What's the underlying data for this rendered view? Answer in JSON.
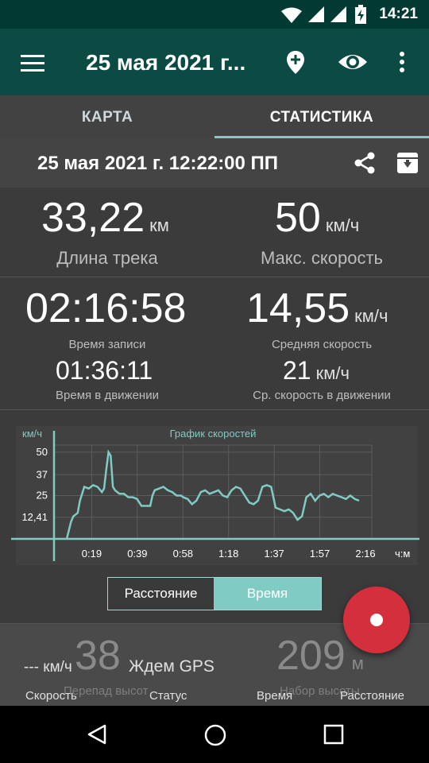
{
  "status_bar": {
    "time": "14:21",
    "icons": [
      "wifi-icon",
      "signal-icon",
      "signal-icon",
      "battery-charging-icon"
    ]
  },
  "app_bar": {
    "title": "25 мая 2021 г...",
    "icons": [
      "menu-icon",
      "add-marker-icon",
      "eye-icon",
      "more-vertical-icon"
    ]
  },
  "tabs": [
    {
      "label": "КАРТА"
    },
    {
      "label": "СТАТИСТИКА",
      "selected": true
    }
  ],
  "track": {
    "datetime": "25 мая 2021 г. 12:22:00 ПП",
    "icons": [
      "share-icon",
      "archive-icon"
    ]
  },
  "stats": {
    "distance": {
      "value": "33,22",
      "unit": "км",
      "label": "Длина трека"
    },
    "max_speed": {
      "value": "50",
      "unit": "км/ч",
      "label": "Макс. скорость"
    },
    "record_time": {
      "value": "02:16:58",
      "label": "Время записи"
    },
    "avg_speed": {
      "value": "14,55",
      "unit": "км/ч",
      "label": "Средняя скорость"
    },
    "moving_time": {
      "value": "01:36:11",
      "label": "Время в движении"
    },
    "avg_moving_speed": {
      "value": "21",
      "unit": "км/ч",
      "label": "Ср. скорость в движении"
    }
  },
  "chart_data": {
    "type": "line",
    "title": "График скоростей",
    "ylabel": "км/ч",
    "xlabel": "ч:м",
    "y_ticks": [
      "50",
      "37",
      "25",
      "12,41"
    ],
    "y_tick_values": [
      50,
      37,
      25,
      12.41
    ],
    "x_ticks": [
      "0:19",
      "0:39",
      "0:58",
      "1:18",
      "1:37",
      "1:57",
      "2:16"
    ],
    "ylim": [
      0,
      55
    ],
    "xlim": [
      0,
      137
    ],
    "grid": true,
    "series": [
      {
        "x": [
          0,
          2,
          3,
          5,
          6,
          8,
          10,
          12,
          14,
          16,
          17,
          18,
          19,
          20,
          21,
          22,
          23,
          24,
          26,
          28,
          30,
          32,
          34,
          36,
          38,
          39,
          40,
          42,
          44,
          46,
          48,
          50,
          52,
          53,
          55,
          57,
          59,
          61,
          63,
          65,
          67,
          69,
          71,
          73,
          75,
          77,
          79,
          81,
          83,
          85,
          87,
          89,
          91,
          93,
          95,
          97,
          99,
          101,
          103,
          105,
          107,
          109,
          111,
          113,
          115,
          117,
          119,
          121,
          123,
          125,
          127,
          129,
          131,
          133
        ],
        "y": [
          0,
          10,
          13,
          15,
          22,
          30,
          29,
          31,
          30,
          27,
          29,
          40,
          50,
          48,
          30,
          28,
          27,
          26,
          26,
          24,
          24,
          23,
          19,
          19,
          19,
          25,
          28,
          29,
          30,
          28,
          27,
          25,
          25,
          24,
          23,
          20,
          22,
          27,
          28,
          26,
          27,
          28,
          25,
          24,
          28,
          30,
          29,
          25,
          21,
          20,
          22,
          30,
          31,
          30,
          18,
          17,
          16,
          17,
          15,
          11,
          13,
          24,
          26,
          22,
          25,
          26,
          24,
          26,
          25,
          24,
          23,
          25,
          23,
          22
        ]
      }
    ]
  },
  "mode_toggle": {
    "option_distance": "Расстояние",
    "option_time": "Время",
    "selected": "Время"
  },
  "bottom": {
    "elevation_diff": {
      "value": "38",
      "label": "Перепад высот"
    },
    "elevation_gain": {
      "value": "209",
      "unit": "м",
      "label": "Набор высоты"
    },
    "speed": {
      "value": "--- км/ч",
      "label": "Скорость"
    },
    "status": {
      "value": "Ждем GPS",
      "label": "Статус"
    },
    "time_label": "Время",
    "distance_label": "Расстояние"
  },
  "colors": {
    "accent": "#80cbc4",
    "appbar": "#0c4a44",
    "fab": "#d32f3c",
    "background": "#3b3b3b"
  },
  "nav": {
    "icons": [
      "back-icon",
      "home-icon",
      "recents-icon"
    ]
  }
}
